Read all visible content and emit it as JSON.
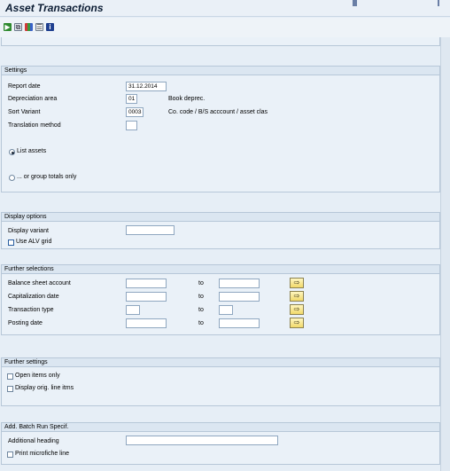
{
  "window": {
    "title": "Asset Transactions"
  },
  "toolbar": {
    "icons": [
      "execute-icon",
      "get-variant-icon",
      "dynamic-selections-icon",
      "selection-options-icon",
      "info-icon"
    ]
  },
  "settings": {
    "header": "Settings",
    "report_date_label": "Report date",
    "report_date_value": "31.12.2014",
    "depreciation_area_label": "Depreciation area",
    "depreciation_area_value": "01",
    "depreciation_area_desc": "Book deprec.",
    "sort_variant_label": "Sort Variant",
    "sort_variant_value": "0003",
    "sort_variant_desc": "Co. code / B/S acccount / asset clas",
    "translation_method_label": "Translation method",
    "translation_method_value": "",
    "list_assets_label": "List assets",
    "group_totals_label": "... or group totals only"
  },
  "display_options": {
    "header": "Display options",
    "display_variant_label": "Display variant",
    "display_variant_value": "",
    "use_alv_grid_label": "Use ALV grid"
  },
  "further_selections": {
    "header": "Further selections",
    "to_label": "to",
    "rows": [
      {
        "label": "Balance sheet account"
      },
      {
        "label": "Capitalization date"
      },
      {
        "label": "Transaction type"
      },
      {
        "label": "Posting date"
      }
    ]
  },
  "further_settings": {
    "header": "Further settings",
    "open_items_label": "Open items only",
    "display_orig_label": "Display orig. line itms"
  },
  "batch_run": {
    "header": "Add. Batch Run Specif.",
    "additional_heading_label": "Additional heading",
    "additional_heading_value": "",
    "print_microfiche_label": "Print microfiche line"
  },
  "colors": {
    "background": "#e6eef6",
    "panel": "#eaf1f8",
    "panel_header": "#dbe6f1",
    "title": "#0b1c33",
    "multiple_selection_button": "#f1d96a"
  }
}
